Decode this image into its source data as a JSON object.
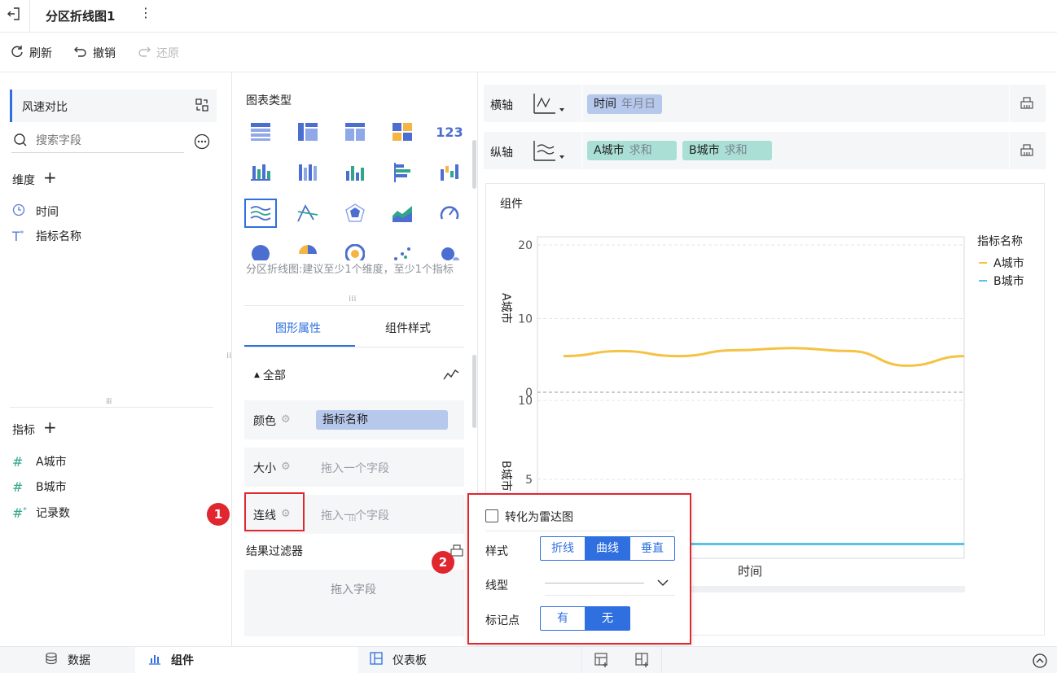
{
  "header": {
    "title": "分区折线图1"
  },
  "toolbar": {
    "refresh": "刷新",
    "undo": "撤销",
    "redo": "还原"
  },
  "left": {
    "dataset": "风速对比",
    "search_placeholder": "搜索字段",
    "dimensions_title": "维度",
    "dimensions": [
      "时间",
      "指标名称"
    ],
    "measures_title": "指标",
    "measures": [
      "A城市",
      "B城市",
      "记录数"
    ]
  },
  "middle": {
    "chart_type_title": "图表类型",
    "chart_hint": "分区折线图:建议至少1个维度，至少1个指标",
    "tabs": [
      "图形属性",
      "组件样式"
    ],
    "all_label": "全部",
    "props": [
      {
        "label": "颜色",
        "value": "指标名称"
      },
      {
        "label": "大小",
        "value": "拖入一个字段"
      },
      {
        "label": "连线",
        "value": "拖入一个字段"
      }
    ],
    "filter_title": "结果过滤器",
    "filter_drop": "拖入字段"
  },
  "axes": {
    "x_label": "横轴",
    "y_label": "纵轴",
    "x_chip": {
      "name": "时间",
      "agg": "年月日"
    },
    "y_chips": [
      {
        "name": "A城市",
        "agg": "求和"
      },
      {
        "name": "B城市",
        "agg": "求和"
      }
    ]
  },
  "chart_data": {
    "type": "line",
    "title": "组件",
    "xlabel": "时间",
    "legend_title": "指标名称",
    "legend_position": "top-right",
    "series": [
      {
        "name": "A城市",
        "color": "#f5c243",
        "ylabel": "A城市",
        "ylim": [
          0,
          20
        ],
        "yticks": [
          0,
          10,
          20
        ],
        "values": [
          4.9,
          5.6,
          4.9,
          5.7,
          6.0,
          5.6,
          3.6,
          4.9
        ]
      },
      {
        "name": "B城市",
        "color": "#5bc0eb",
        "ylabel": "B城市",
        "ylim": [
          0,
          10
        ],
        "yticks": [
          5,
          10
        ],
        "values": [
          0.9,
          0.9,
          0.9,
          0.9,
          0.9,
          0.9,
          0.9,
          0.9
        ]
      }
    ]
  },
  "popup": {
    "radar_label": "转化为雷达图",
    "style_label": "样式",
    "styles": [
      "折线",
      "曲线",
      "垂直"
    ],
    "style_selected": "曲线",
    "line_type_label": "线型",
    "marker_label": "标记点",
    "markers": [
      "有",
      "无"
    ],
    "marker_selected": "无"
  },
  "annotations": {
    "badge1": "1",
    "badge2": "2"
  },
  "bottom_tabs": [
    "数据",
    "组件",
    "仪表板"
  ]
}
